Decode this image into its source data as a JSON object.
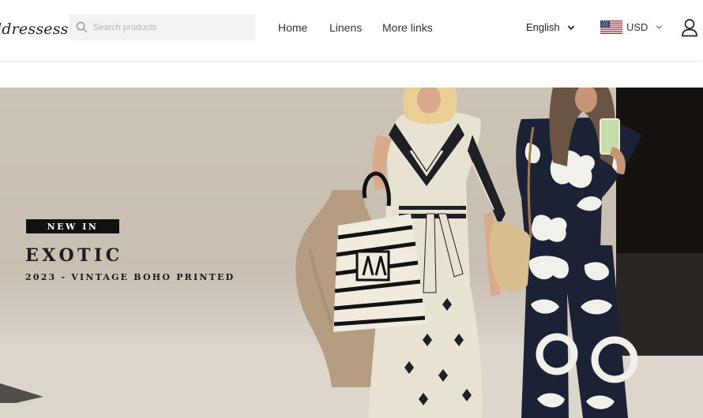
{
  "header": {
    "logo_text": "ldressess",
    "search": {
      "placeholder": "Search products",
      "value": ""
    },
    "nav": [
      {
        "label": "Home"
      },
      {
        "label": "Linens"
      },
      {
        "label": "More links"
      }
    ],
    "language": {
      "selected": "English"
    },
    "currency": {
      "selected": "USD",
      "flag": "us-flag-icon"
    },
    "account_icon": "user-icon"
  },
  "hero": {
    "badge": "NEW IN",
    "title": "EXOTIC",
    "subtitle": "2023 - VINTAGE BOHO PRINTED"
  },
  "colors": {
    "badge_bg": "#111111",
    "search_bg": "#f3f3f3",
    "wall": "#c8bfb2"
  }
}
